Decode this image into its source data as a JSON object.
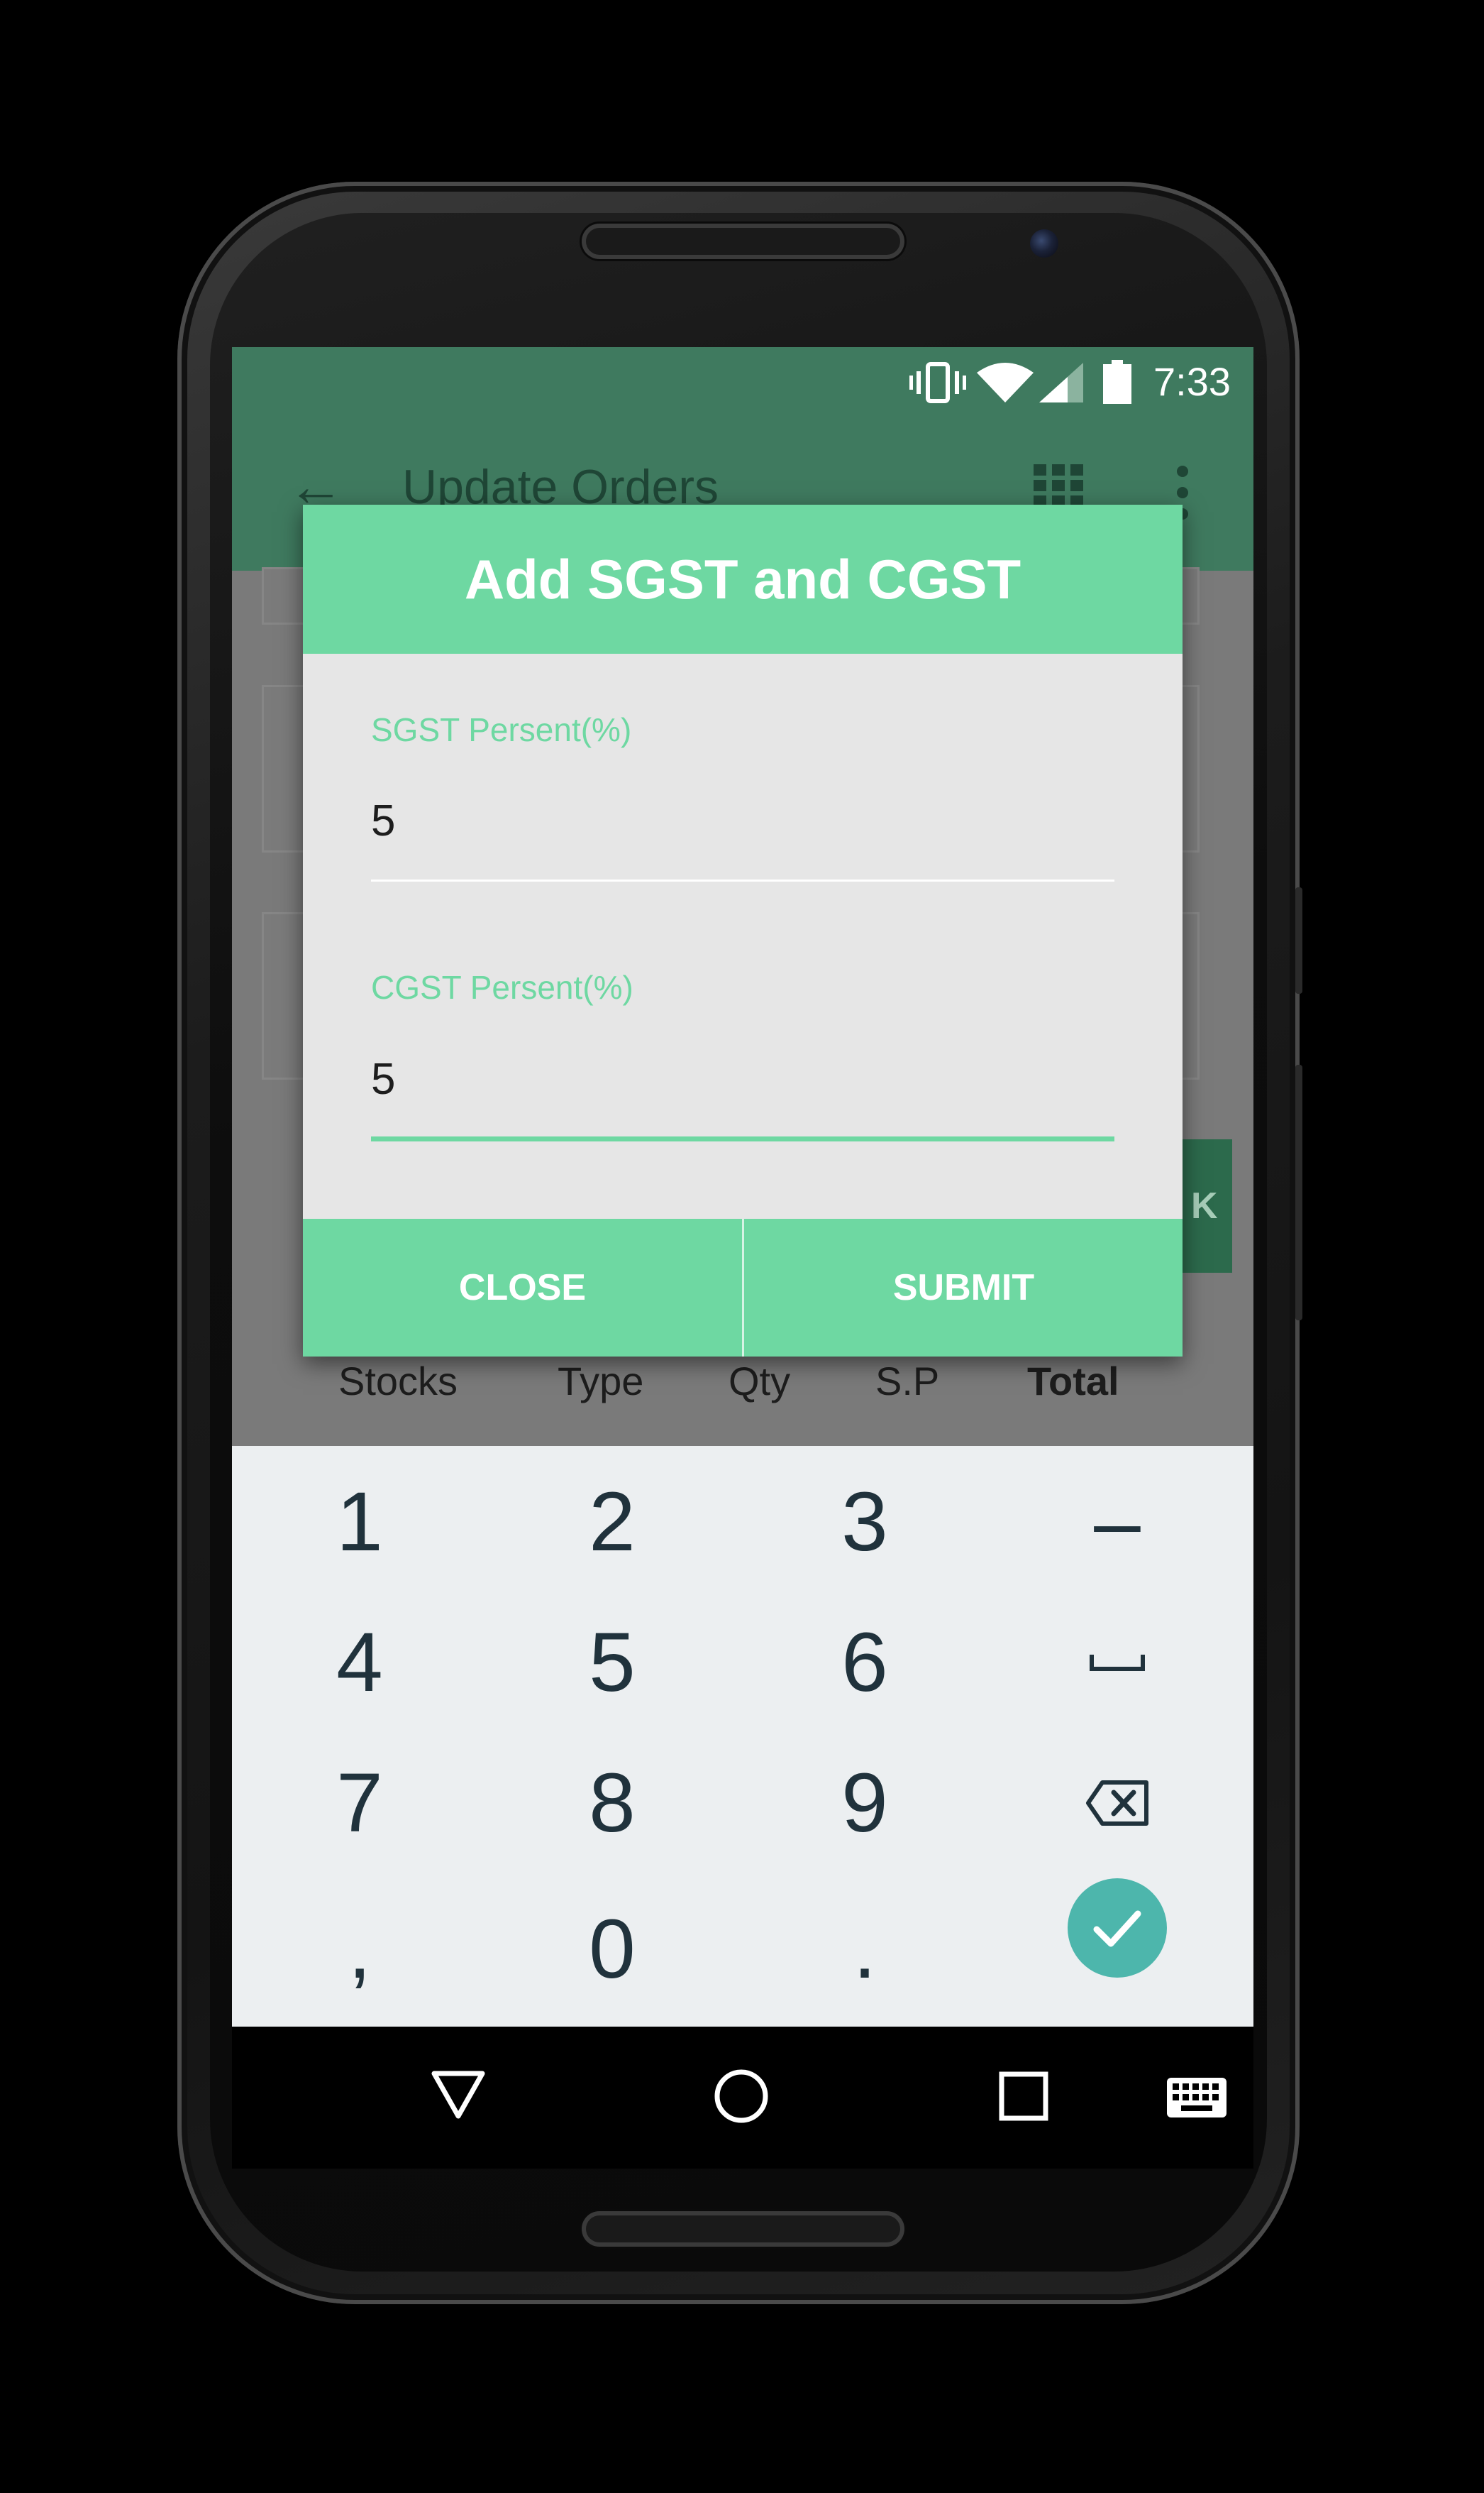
{
  "status_bar": {
    "time": "7:33",
    "icons": [
      "vibrate-icon",
      "wifi-icon",
      "signal-icon",
      "battery-icon"
    ]
  },
  "app_bar": {
    "title": "Update Orders",
    "icons": [
      "back-arrow-icon",
      "grid-icon",
      "more-vert-icon"
    ]
  },
  "background": {
    "button_partial": "K",
    "columns": [
      "Stocks",
      "Type",
      "Qty",
      "S.P",
      "Total"
    ]
  },
  "dialog": {
    "title": "Add SGST and CGST",
    "sgst": {
      "label": "SGST Persent(%)",
      "value": "5"
    },
    "cgst": {
      "label": "CGST Persent(%)",
      "value": "5"
    },
    "close_label": "CLOSE",
    "submit_label": "SUBMIT"
  },
  "keypad": {
    "row1": [
      "1",
      "2",
      "3",
      "–"
    ],
    "row2": [
      "4",
      "5",
      "6"
    ],
    "row3": [
      "7",
      "8",
      "9"
    ],
    "row4": [
      ",",
      "0",
      "."
    ],
    "icons": [
      "space-icon",
      "backspace-icon",
      "check-icon"
    ]
  },
  "nav_bar": {
    "icons": [
      "back-triangle-icon",
      "home-circle-icon",
      "recents-square-icon",
      "keyboard-icon"
    ]
  },
  "colors": {
    "accent": "#6ed8a2",
    "appbar": "#3f7a5f",
    "enter": "#4db6ac"
  }
}
